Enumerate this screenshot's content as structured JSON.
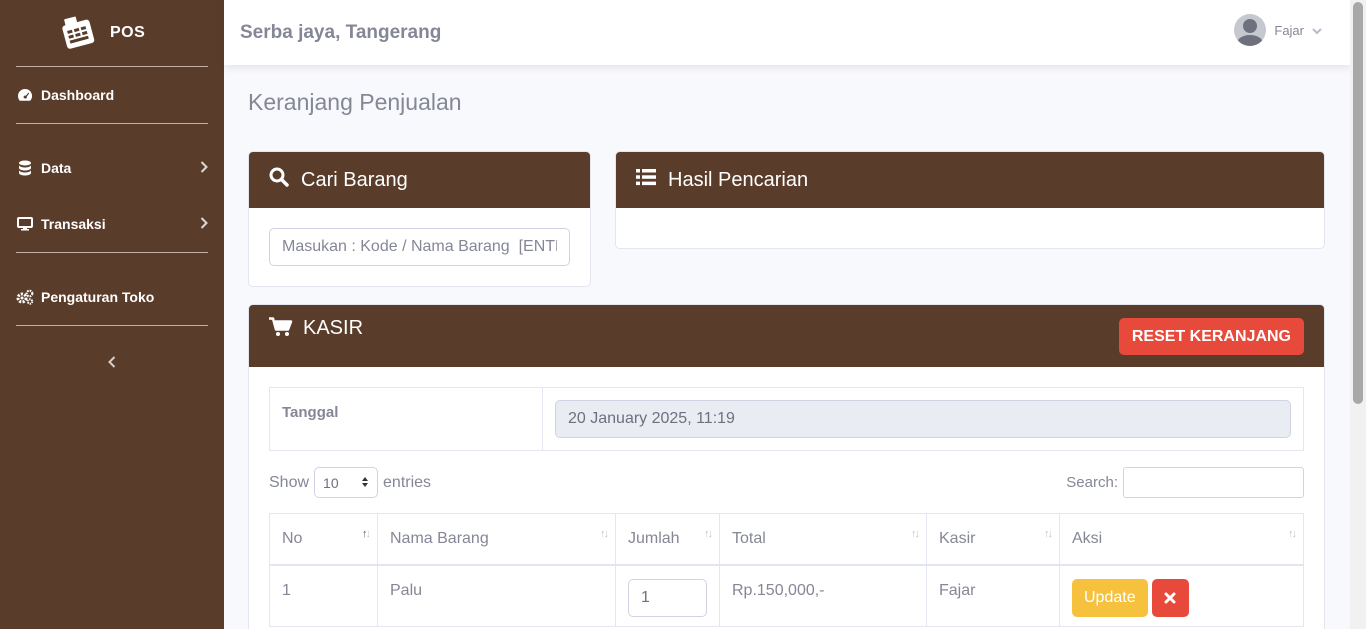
{
  "sidebar": {
    "brand": "POS",
    "items": [
      {
        "label": "Dashboard",
        "icon": "tachometer-icon"
      },
      {
        "label": "Data",
        "icon": "database-icon"
      },
      {
        "label": "Transaksi",
        "icon": "desktop-icon"
      },
      {
        "label": "Pengaturan Toko",
        "icon": "cogs-icon"
      }
    ]
  },
  "topbar": {
    "store_name": "Serba jaya, Tangerang",
    "user_name": "Fajar"
  },
  "page": {
    "title": "Keranjang Penjualan"
  },
  "cari_barang": {
    "title": "Cari Barang",
    "placeholder": "Masukan : Kode / Nama Barang  [ENTER]"
  },
  "hasil_pencarian": {
    "title": "Hasil Pencarian"
  },
  "kasir": {
    "title": "KASIR",
    "reset_label": "RESET KERANJANG",
    "tanggal_label": "Tanggal",
    "tanggal_value": "20 January 2025, 11:19",
    "show_label": "Show",
    "entries_value": "10",
    "entries_label": "entries",
    "search_label": "Search:",
    "columns": [
      "No",
      "Nama Barang",
      "Jumlah",
      "Total",
      "Kasir",
      "Aksi"
    ],
    "rows": [
      {
        "no": "1",
        "nama": "Palu",
        "jumlah": "1",
        "total": "Rp.150,000,-",
        "kasir": "Fajar",
        "update_label": "Update"
      }
    ]
  },
  "colors": {
    "brand": "#5a3c2a",
    "danger": "#e74a3b",
    "warning": "#f6c23e"
  }
}
